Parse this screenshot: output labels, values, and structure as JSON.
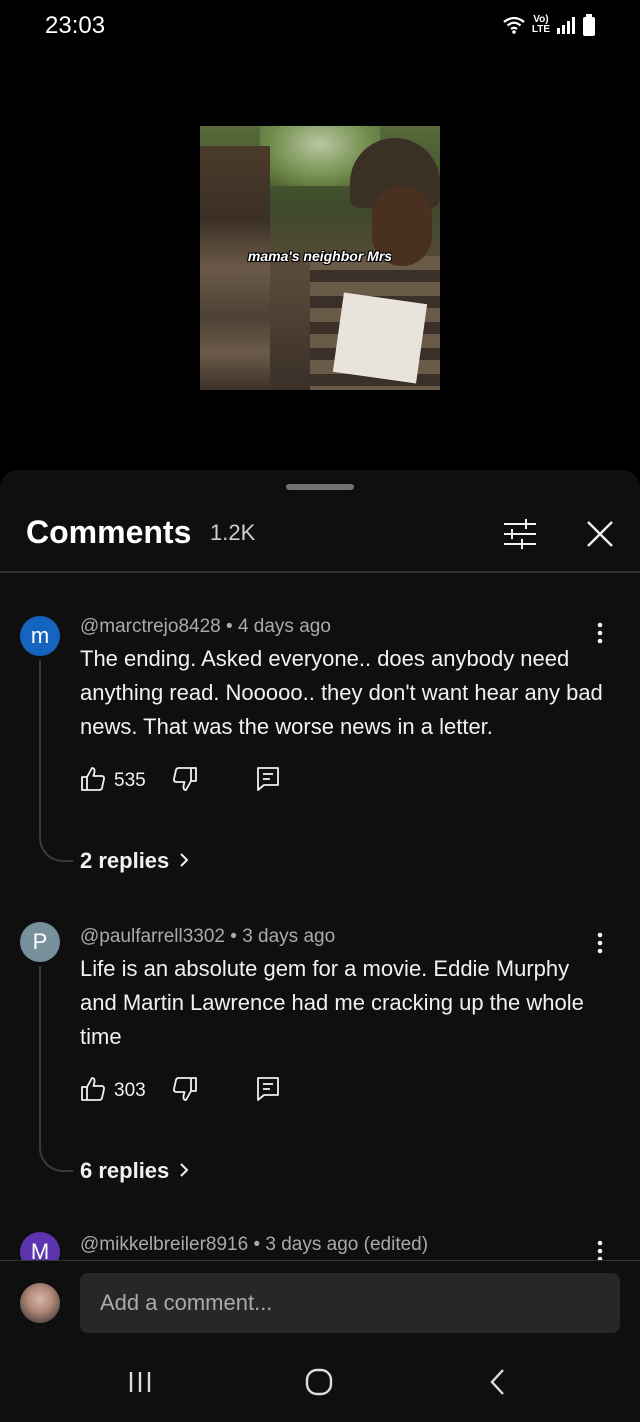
{
  "status_bar": {
    "time": "23:03",
    "network_label_top": "Vo)",
    "network_label_bottom": "LTE",
    "icons": [
      "wifi-icon",
      "signal-icon",
      "battery-icon"
    ]
  },
  "video": {
    "caption": "mama's neighbor Mrs"
  },
  "comments_panel": {
    "title": "Comments",
    "count": "1.2K",
    "icons": [
      "filter-icon",
      "close-icon"
    ]
  },
  "comments": [
    {
      "avatar_letter": "m",
      "avatar_color": "#1565c0",
      "meta": "@marctrejo8428 • 4 days ago",
      "text": "The ending. Asked everyone.. does anybody need anything read. Nooooo.. they don't want hear any bad news. That was the worse news in a letter.",
      "likes": "535",
      "replies": "2 replies"
    },
    {
      "avatar_letter": "P",
      "avatar_color": "#78909c",
      "meta": "@paulfarrell3302 • 3 days ago",
      "text": "Life is an absolute gem for a movie. Eddie Murphy and Martin Lawrence had me cracking up the whole time",
      "likes": "303",
      "replies": "6 replies"
    },
    {
      "avatar_letter": "M",
      "avatar_color": "#5e35b1",
      "meta": "@mikkelbreiler8916 • 3 days ago (edited)"
    }
  ],
  "add_comment": {
    "placeholder": "Add a comment..."
  },
  "colors": {
    "background": "#0f0f0f",
    "text": "#f1f1f1",
    "secondary_text": "#aaaaaa"
  }
}
